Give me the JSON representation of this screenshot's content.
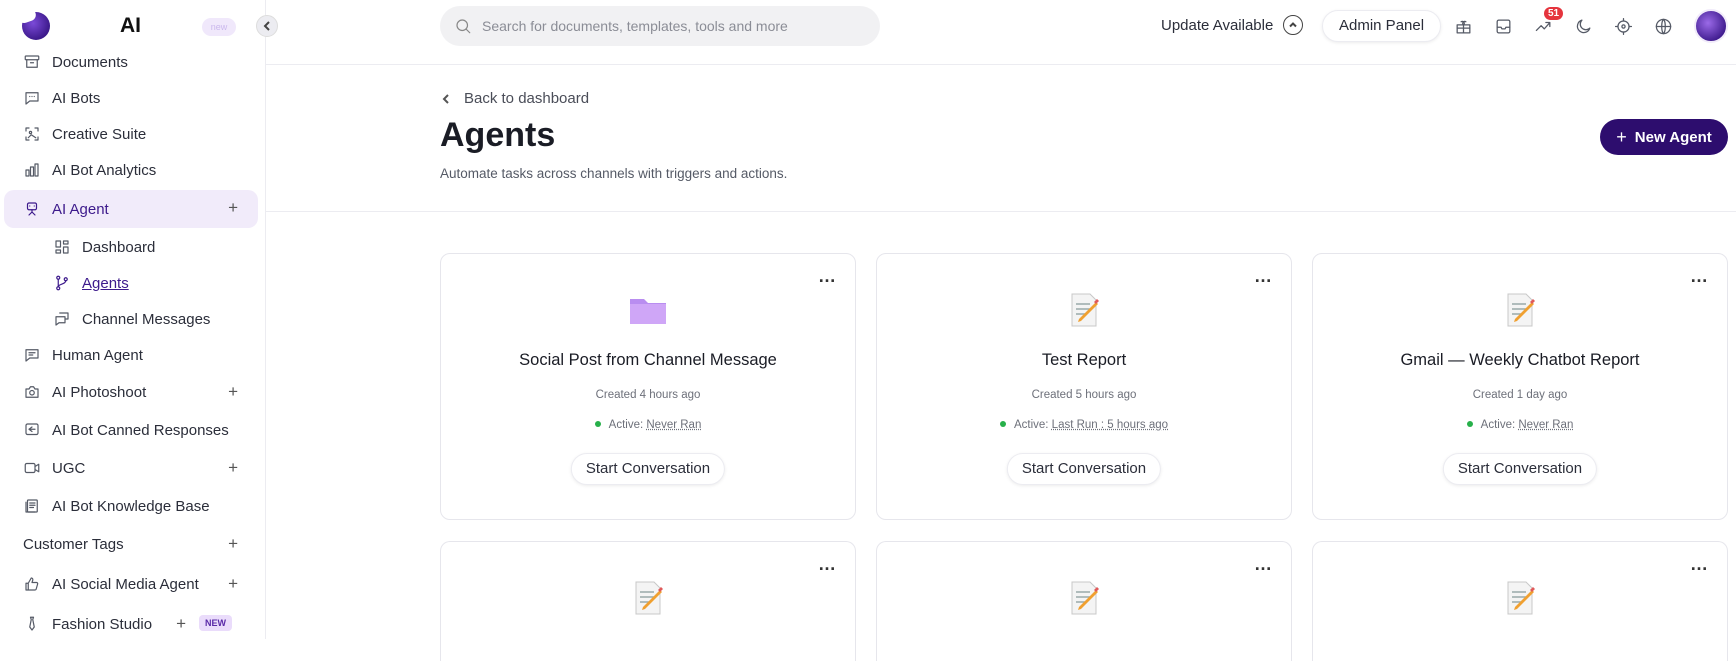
{
  "brand": {
    "name": "AI",
    "badge": "new"
  },
  "sidebar": {
    "items": [
      {
        "label": "Documents",
        "icon": "archive-icon"
      },
      {
        "label": "AI Bots",
        "icon": "chat-icon"
      },
      {
        "label": "Creative Suite",
        "icon": "image-icon"
      },
      {
        "label": "AI Bot Analytics",
        "icon": "bar-chart-icon"
      },
      {
        "label": "AI Agent",
        "icon": "robot-icon",
        "plus": "+"
      },
      {
        "label": "Dashboard",
        "icon": "dashboard-icon"
      },
      {
        "label": "Agents",
        "icon": "branch-icon"
      },
      {
        "label": "Channel Messages",
        "icon": "messages-icon"
      },
      {
        "label": "Human Agent",
        "icon": "chat-lines-icon"
      },
      {
        "label": "AI Photoshoot",
        "icon": "camera-icon",
        "plus": "+"
      },
      {
        "label": "AI Bot Canned Responses",
        "icon": "reply-icon"
      },
      {
        "label": "UGC",
        "icon": "video-icon",
        "plus": "+"
      },
      {
        "label": "AI Bot Knowledge Base",
        "icon": "book-icon"
      },
      {
        "label": "Customer Tags",
        "plus": "+"
      },
      {
        "label": "AI Social Media Agent",
        "icon": "thumbs-up-icon",
        "plus": "+"
      },
      {
        "label": "Fashion Studio",
        "icon": "tie-icon",
        "plus": "+",
        "badge": "NEW"
      }
    ]
  },
  "topbar": {
    "search_placeholder": "Search for documents, templates, tools and more",
    "update_label": "Update Available",
    "admin_label": "Admin Panel",
    "notification_count": "51"
  },
  "header": {
    "back_label": "Back to dashboard",
    "title": "Agents",
    "subtitle": "Automate tasks across channels with triggers and actions.",
    "new_agent_label": "New Agent"
  },
  "cards": [
    {
      "title": "Social Post from Channel Message",
      "icon": "folder-icon",
      "created": "Created 4 hours ago",
      "status_prefix": "Active:",
      "status_value": "Never Ran",
      "button": "Start Conversation",
      "menu": "…"
    },
    {
      "title": "Test Report",
      "icon": "memo-icon",
      "created": "Created 5 hours ago",
      "status_prefix": "Active:",
      "status_value": "Last Run : 5 hours ago",
      "button": "Start Conversation",
      "menu": "…"
    },
    {
      "title": "Gmail — Weekly Chatbot Report",
      "icon": "memo-icon",
      "created": "Created 1 day ago",
      "status_prefix": "Active:",
      "status_value": "Never Ran",
      "button": "Start Conversation",
      "menu": "…"
    },
    {
      "icon": "memo-icon",
      "menu": "…"
    },
    {
      "icon": "memo-icon",
      "menu": "…"
    },
    {
      "icon": "memo-icon",
      "menu": "…"
    }
  ]
}
